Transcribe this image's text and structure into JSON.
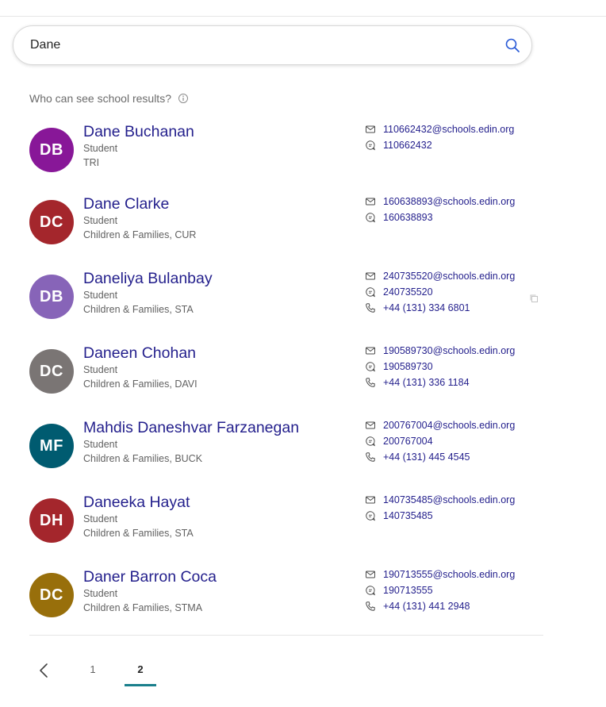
{
  "search": {
    "value": "Dane",
    "placeholder": "Search"
  },
  "visibility_note": {
    "text": "Who can see school results?",
    "icon": "info-icon"
  },
  "results": [
    {
      "initials": "DB",
      "avatar_color": "#881798",
      "name": "Dane Buchanan",
      "role": "Student",
      "department": "TRI",
      "email": "110662432@schools.edin.org",
      "chat": "110662432",
      "phone": null
    },
    {
      "initials": "DC",
      "avatar_color": "#a4262c",
      "name": "Dane Clarke",
      "role": "Student",
      "department": "Children & Families, CUR",
      "email": "160638893@schools.edin.org",
      "chat": "160638893",
      "phone": null
    },
    {
      "initials": "DB",
      "avatar_color": "#8764b8",
      "name": "Daneliya Bulanbay",
      "role": "Student",
      "department": "Children & Families, STA",
      "email": "240735520@schools.edin.org",
      "chat": "240735520",
      "phone": "+44 (131) 334 6801"
    },
    {
      "initials": "DC",
      "avatar_color": "#7a7574",
      "name": "Daneen Chohan",
      "role": "Student",
      "department": "Children & Families, DAVI",
      "email": "190589730@schools.edin.org",
      "chat": "190589730",
      "phone": "+44 (131) 336 1184"
    },
    {
      "initials": "MF",
      "avatar_color": "#005b70",
      "name": "Mahdis Daneshvar Farzanegan",
      "role": "Student",
      "department": "Children & Families, BUCK",
      "email": "200767004@schools.edin.org",
      "chat": "200767004",
      "phone": "+44 (131) 445 4545"
    },
    {
      "initials": "DH",
      "avatar_color": "#a4262c",
      "name": "Daneeka Hayat",
      "role": "Student",
      "department": "Children & Families, STA",
      "email": "140735485@schools.edin.org",
      "chat": "140735485",
      "phone": null
    },
    {
      "initials": "DC",
      "avatar_color": "#986f0b",
      "name": "Daner Barron Coca",
      "role": "Student",
      "department": "Children & Families, STMA",
      "email": "190713555@schools.edin.org",
      "chat": "190713555",
      "phone": "+44 (131) 441 2948"
    }
  ],
  "pagination": {
    "pages": [
      "1",
      "2"
    ],
    "current": "2",
    "accent_color": "#1a7f8c"
  },
  "icons": {
    "search": "search-icon",
    "email": "mail-icon",
    "chat": "chat-icon",
    "phone": "phone-icon",
    "copy": "copy-icon",
    "prev": "chevron-left-icon"
  }
}
